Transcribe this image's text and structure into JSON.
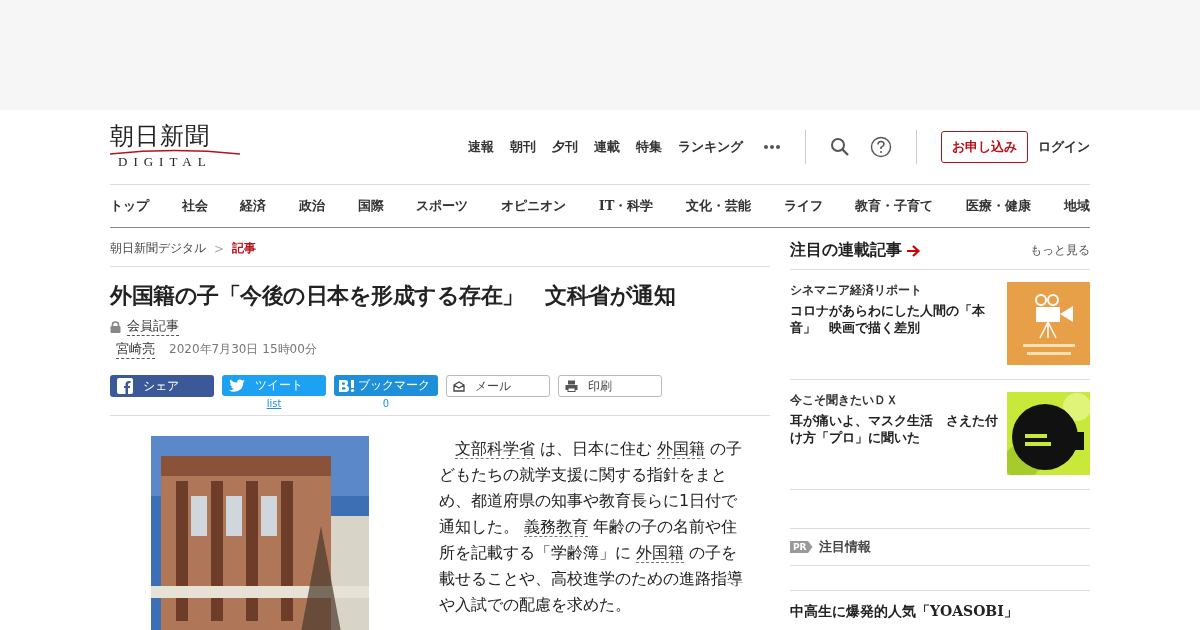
{
  "logo": {
    "name": "朝日新聞",
    "sub": "DIGITAL"
  },
  "top_links": [
    "速報",
    "朝刊",
    "夕刊",
    "連載",
    "特集",
    "ランキング"
  ],
  "subscribe": "お申し込み",
  "login": "ログイン",
  "nav": [
    {
      "label": "トップ"
    },
    {
      "label": "社会"
    },
    {
      "label": "経済"
    },
    {
      "label": "政治"
    },
    {
      "label": "国際"
    },
    {
      "label": "スポーツ"
    },
    {
      "label": "オピニオン"
    },
    {
      "label": "IT・科学"
    },
    {
      "label": "文化・芸能"
    },
    {
      "label": "ライフ"
    },
    {
      "label": "教育・子育て"
    },
    {
      "label": "医療・健康"
    },
    {
      "label": "地域"
    }
  ],
  "breadcrumb_separator": ">",
  "breadcrumb": [
    {
      "label": "朝日新聞デジタル",
      "current": false
    },
    {
      "label": "記事",
      "current": true
    }
  ],
  "article": {
    "title": "外国籍の子「今後の日本を形成する存在」　文科省が通知",
    "member": "会員記事",
    "author": "宮崎亮",
    "date": "2020年7月30日 15時00分",
    "share": [
      {
        "kind": "facebook",
        "label": "シェア"
      },
      {
        "kind": "twitter",
        "label": "ツイート",
        "count": "list"
      },
      {
        "kind": "hatena",
        "label": "ブックマーク",
        "count": "0"
      },
      {
        "kind": "mail",
        "label": "メール"
      },
      {
        "kind": "print",
        "label": "印刷"
      }
    ],
    "body": [
      {
        "kind": "term",
        "text": "文部科学省"
      },
      {
        "kind": "plain",
        "text": " は、日本に住む "
      },
      {
        "kind": "term",
        "text": "外国籍"
      },
      {
        "kind": "plain",
        "text": " の子どもたちの就学支援に関する指針をまとめ、都道府県の知事や教育長らに1日付で通知した。 "
      },
      {
        "kind": "term",
        "text": "義務教育"
      },
      {
        "kind": "plain",
        "text": " 年齢の子の名前や住所を記載する「学齢簿」に "
      },
      {
        "kind": "term",
        "text": "外国籍"
      },
      {
        "kind": "plain",
        "text": " の子を載せることや、高校進学のための進路指導や入試での配慮を求めた。"
      }
    ]
  },
  "sidebar": {
    "title": "注目の連載記事",
    "more": "もっと見る",
    "items": [
      {
        "series": "シネマニア経済リポート",
        "headline": "コロナがあらわにした人間の「本音」　映画で描く差別"
      },
      {
        "series": "今こそ聞きたいＤＸ",
        "headline": "耳が痛いよ、マスク生活　さえた付け方「プロ」に聞いた"
      }
    ],
    "pr_badge": "PR",
    "pr_title": "注目情報",
    "pr_headline": "中高生に爆発的人気「YOASOBI」"
  }
}
